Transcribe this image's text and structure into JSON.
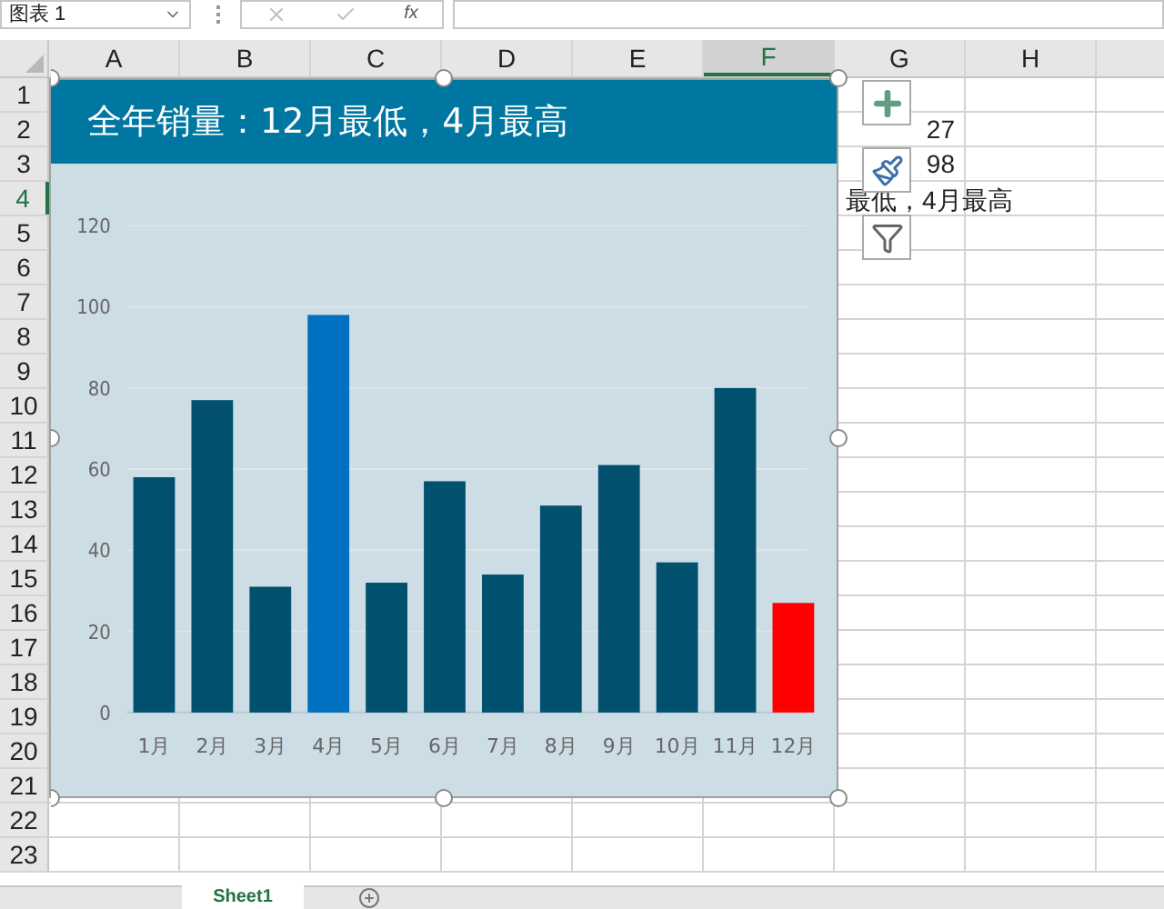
{
  "formula_bar": {
    "name_box": "图表 1",
    "function_label": "fx"
  },
  "columns": [
    {
      "label": "A",
      "selected": false
    },
    {
      "label": "B",
      "selected": false
    },
    {
      "label": "C",
      "selected": false
    },
    {
      "label": "D",
      "selected": false
    },
    {
      "label": "E",
      "selected": false
    },
    {
      "label": "F",
      "selected": true
    },
    {
      "label": "G",
      "selected": false
    },
    {
      "label": "H",
      "selected": false
    }
  ],
  "rows": [
    {
      "label": "1",
      "selected": false
    },
    {
      "label": "2",
      "selected": false
    },
    {
      "label": "3",
      "selected": false
    },
    {
      "label": "4",
      "selected": true
    },
    {
      "label": "5",
      "selected": false
    },
    {
      "label": "6",
      "selected": false
    },
    {
      "label": "7",
      "selected": false
    },
    {
      "label": "8",
      "selected": false
    },
    {
      "label": "9",
      "selected": false
    },
    {
      "label": "10",
      "selected": false
    },
    {
      "label": "11",
      "selected": false
    },
    {
      "label": "12",
      "selected": false
    },
    {
      "label": "13",
      "selected": false
    },
    {
      "label": "14",
      "selected": false
    },
    {
      "label": "15",
      "selected": false
    },
    {
      "label": "16",
      "selected": false
    },
    {
      "label": "17",
      "selected": false
    },
    {
      "label": "18",
      "selected": false
    },
    {
      "label": "19",
      "selected": false
    },
    {
      "label": "20",
      "selected": false
    },
    {
      "label": "21",
      "selected": false
    },
    {
      "label": "22",
      "selected": false
    },
    {
      "label": "23",
      "selected": false
    }
  ],
  "cells": [
    {
      "text": "27",
      "kind": "number"
    },
    {
      "text": "98",
      "kind": "number"
    },
    {
      "text": "最低，4月最高",
      "kind": "text"
    }
  ],
  "chart": {
    "title": "全年销量：12月最低，4月最高",
    "chart_data": {
      "type": "bar",
      "categories": [
        "1月",
        "2月",
        "3月",
        "4月",
        "5月",
        "6月",
        "7月",
        "8月",
        "9月",
        "10月",
        "11月",
        "12月"
      ],
      "series": [
        {
          "color": "#00506e",
          "values": [
            58,
            77,
            31,
            null,
            32,
            57,
            34,
            51,
            61,
            37,
            80,
            null
          ]
        },
        {
          "color": "#0070c0",
          "values": [
            null,
            null,
            null,
            98,
            null,
            null,
            null,
            null,
            null,
            null,
            null,
            null
          ]
        },
        {
          "color": "#ff0000",
          "values": [
            null,
            null,
            null,
            null,
            null,
            null,
            null,
            null,
            null,
            null,
            null,
            27
          ]
        }
      ],
      "stacked": true,
      "grid": true,
      "ylim": [
        0,
        120
      ],
      "yticks": [
        0,
        20,
        40,
        60,
        80,
        100,
        120
      ]
    }
  },
  "sheet_tabs": [
    {
      "label": "Sheet1",
      "selected": true
    }
  ]
}
